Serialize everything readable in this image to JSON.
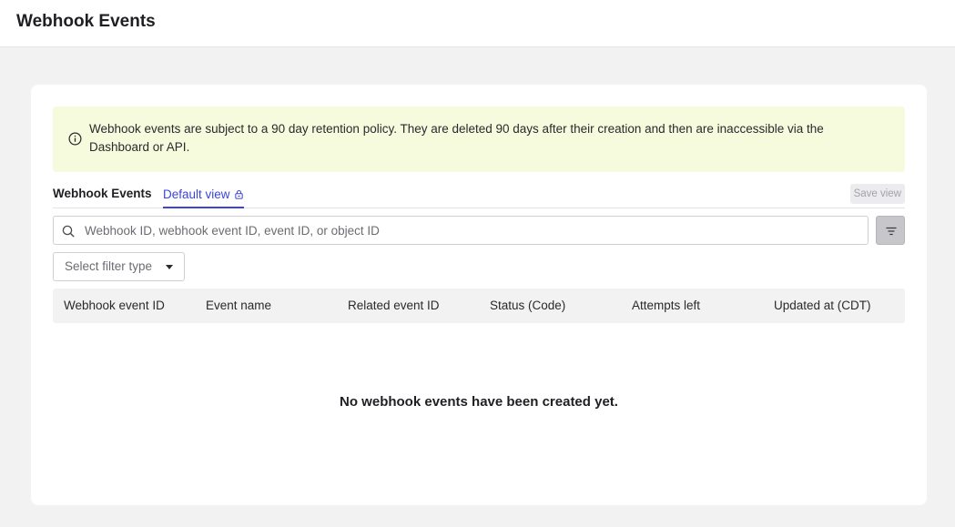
{
  "header": {
    "title": "Webhook Events"
  },
  "notice": {
    "icon": "info-icon",
    "text": "Webhook events are subject to a 90 day retention policy. They are deleted 90 days after their creation and then are inaccessible via the Dashboard or API."
  },
  "tabs": {
    "title": "Webhook Events",
    "default_view": "Default view",
    "default_view_icon": "lock-icon",
    "save_view": "Save view",
    "accent_color": "#3b44d6"
  },
  "search": {
    "placeholder": "Webhook ID, webhook event ID, event ID, or object ID",
    "value": "",
    "icon": "search-icon"
  },
  "filter": {
    "button_icon": "filter-lines-icon",
    "select_placeholder": "Select filter type"
  },
  "table": {
    "columns": [
      "Webhook event ID",
      "Event name",
      "Related event ID",
      "Status (Code)",
      "Attempts left",
      "Updated at (CDT)"
    ],
    "rows": [],
    "empty_message": "No webhook events have been created yet."
  }
}
